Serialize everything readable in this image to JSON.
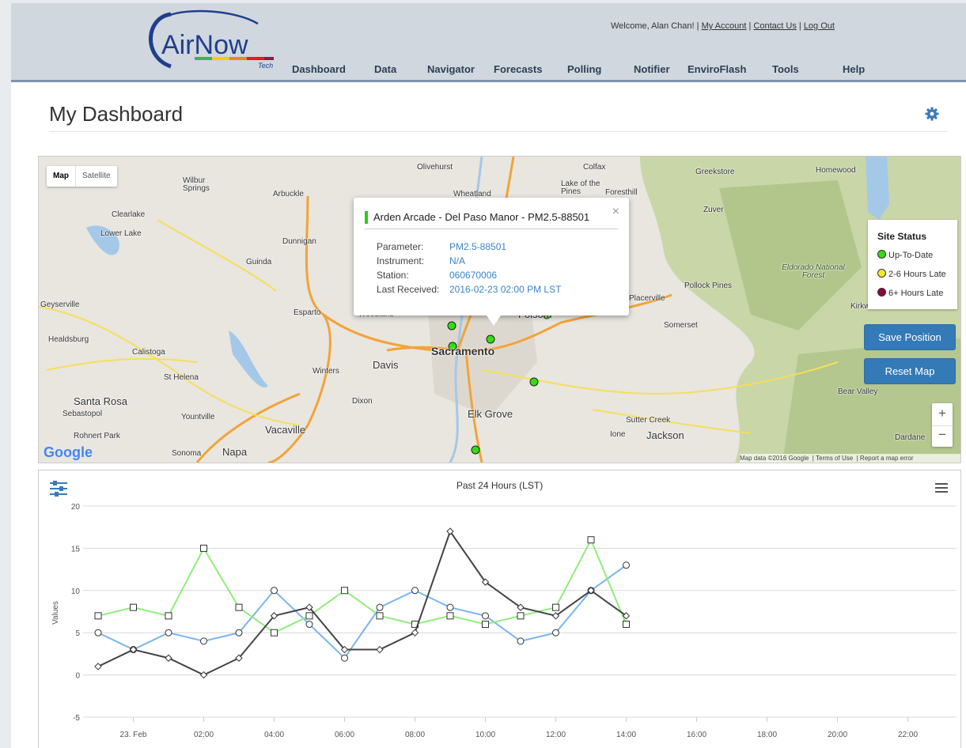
{
  "header": {
    "logo_text": "AirNow",
    "logo_sub": "Tech",
    "welcome": "Welcome, Alan Chan!",
    "links": [
      "My Account",
      "Contact Us",
      "Log Out"
    ],
    "nav": [
      "Dashboard",
      "Data",
      "Navigator",
      "Forecasts",
      "Polling",
      "Notifier",
      "EnviroFlash",
      "Tools",
      "Help"
    ]
  },
  "page_title": "My Dashboard",
  "map": {
    "toggle": [
      "Map",
      "Satellite"
    ],
    "labels": [
      "Olivehurst",
      "Colfax",
      "Lake of the Pines",
      "Wheatland",
      "Foresthill",
      "Greekstore",
      "Homewood",
      "Wilbur Springs",
      "Arbuckle",
      "Clearlake",
      "Lower Lake",
      "Zuver",
      "Dunnigan",
      "Guinda",
      "Eldorado National Forest",
      "Pollock Pines",
      "Placerville",
      "Geyserville",
      "Esparto",
      "Woodland",
      "Folsom",
      "Somerset",
      "Kirkwood",
      "Healdsburg",
      "Calistoga",
      "Sacramento",
      "Davis",
      "Winters",
      "St Helena",
      "Santa Rosa",
      "Sebastopol",
      "Yountville",
      "Dixon",
      "Elk Grove",
      "Sutter Creek",
      "Jackson",
      "Ione",
      "Bear Valley",
      "Rohnert Park",
      "Vacaville",
      "Sonoma",
      "Napa",
      "Dardane"
    ],
    "popup": {
      "title": "Arden Arcade - Del Paso Manor - PM2.5-88501",
      "close": "×",
      "rows": [
        {
          "k": "Parameter:",
          "v": "PM2.5-88501"
        },
        {
          "k": "Instrument:",
          "v": "N/A"
        },
        {
          "k": "Station:",
          "v": "060670006"
        },
        {
          "k": "Last Received:",
          "v": "2016-02-23 02:00 PM LST"
        }
      ]
    },
    "legend": {
      "title": "Site Status",
      "items": [
        {
          "label": "Up-To-Date",
          "color": "#33dd11"
        },
        {
          "label": "2-6 Hours Late",
          "color": "#f5e92a"
        },
        {
          "label": "6+ Hours Late",
          "color": "#8b0a3a"
        }
      ]
    },
    "buttons": {
      "save": "Save Position",
      "reset": "Reset Map"
    },
    "zoom": {
      "in": "+",
      "out": "−"
    },
    "google": "Google",
    "footer": [
      "Map data ©2016 Google",
      "Terms of Use",
      "Report a map error"
    ]
  },
  "chart_data": {
    "type": "line",
    "title": "Past 24 Hours (LST)",
    "ylabel": "Values",
    "xlabel": "",
    "ylim": [
      -5,
      20
    ],
    "yticks": [
      -5,
      0,
      5,
      10,
      15,
      20
    ],
    "xticks": [
      "23. Feb",
      "02:00",
      "04:00",
      "06:00",
      "08:00",
      "10:00",
      "12:00",
      "14:00",
      "16:00",
      "18:00",
      "20:00",
      "22:00"
    ],
    "x_hours": [
      0,
      1,
      2,
      3,
      4,
      5,
      6,
      7,
      8,
      9,
      10,
      11,
      12,
      13,
      14
    ],
    "series": [
      {
        "color": "#7cb5ec",
        "marker": "circle",
        "values": [
          5,
          3,
          5,
          4,
          5,
          10,
          6,
          2,
          8,
          10,
          8,
          7,
          4,
          5,
          10,
          13
        ]
      },
      {
        "color": "#90ed7d",
        "marker": "square",
        "values": [
          7,
          8,
          7,
          15,
          8,
          5,
          7,
          10,
          7,
          6,
          7,
          6,
          7,
          8,
          16,
          6
        ]
      },
      {
        "color": "#434348",
        "marker": "diamond",
        "values": [
          1,
          3,
          2,
          0,
          2,
          7,
          8,
          3,
          3,
          5,
          17,
          11,
          8,
          7,
          10,
          7
        ]
      }
    ]
  }
}
